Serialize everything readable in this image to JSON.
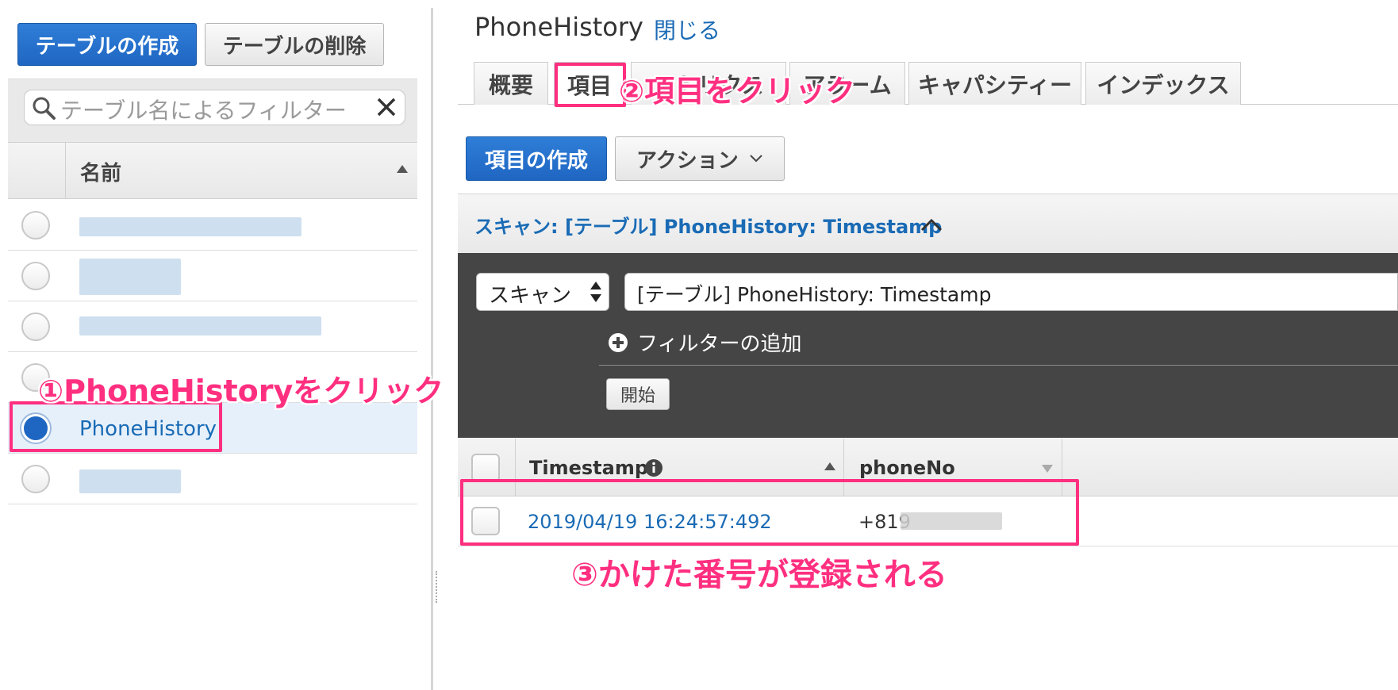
{
  "left": {
    "create_table": "テーブルの作成",
    "delete_table": "テーブルの削除",
    "filter_placeholder": "テーブル名によるフィルター",
    "col_name": "名前",
    "selected_table": "PhoneHistory"
  },
  "right": {
    "title": "PhoneHistory",
    "close_link": "閉じる",
    "tabs": [
      {
        "label": "概要"
      },
      {
        "label": "項目"
      },
      {
        "label": "メトリクス"
      },
      {
        "label": "アラーム"
      },
      {
        "label": "キャパシティー"
      },
      {
        "label": "インデックス"
      }
    ],
    "create_item": "項目の作成",
    "action": "アクション",
    "scan_header": "スキャン: [テーブル] PhoneHistory: Timestamp",
    "scan_select": "スキャン",
    "scan_target": "[テーブル] PhoneHistory: Timestamp",
    "add_filter": "フィルターの追加",
    "start": "開始",
    "columns": {
      "timestamp": "Timestamp",
      "phone": "phoneNo"
    },
    "row": {
      "timestamp": "2019/04/19 16:24:57:492",
      "phone": "+819"
    }
  },
  "annotations": {
    "step1": "①PhoneHistoryをクリック",
    "step2": "②項目をクリック",
    "step3": "③かけた番号が登録される"
  },
  "colors": {
    "accent": "#1f66c2",
    "annotation": "#ff2f80",
    "link": "#1a6bb5"
  }
}
